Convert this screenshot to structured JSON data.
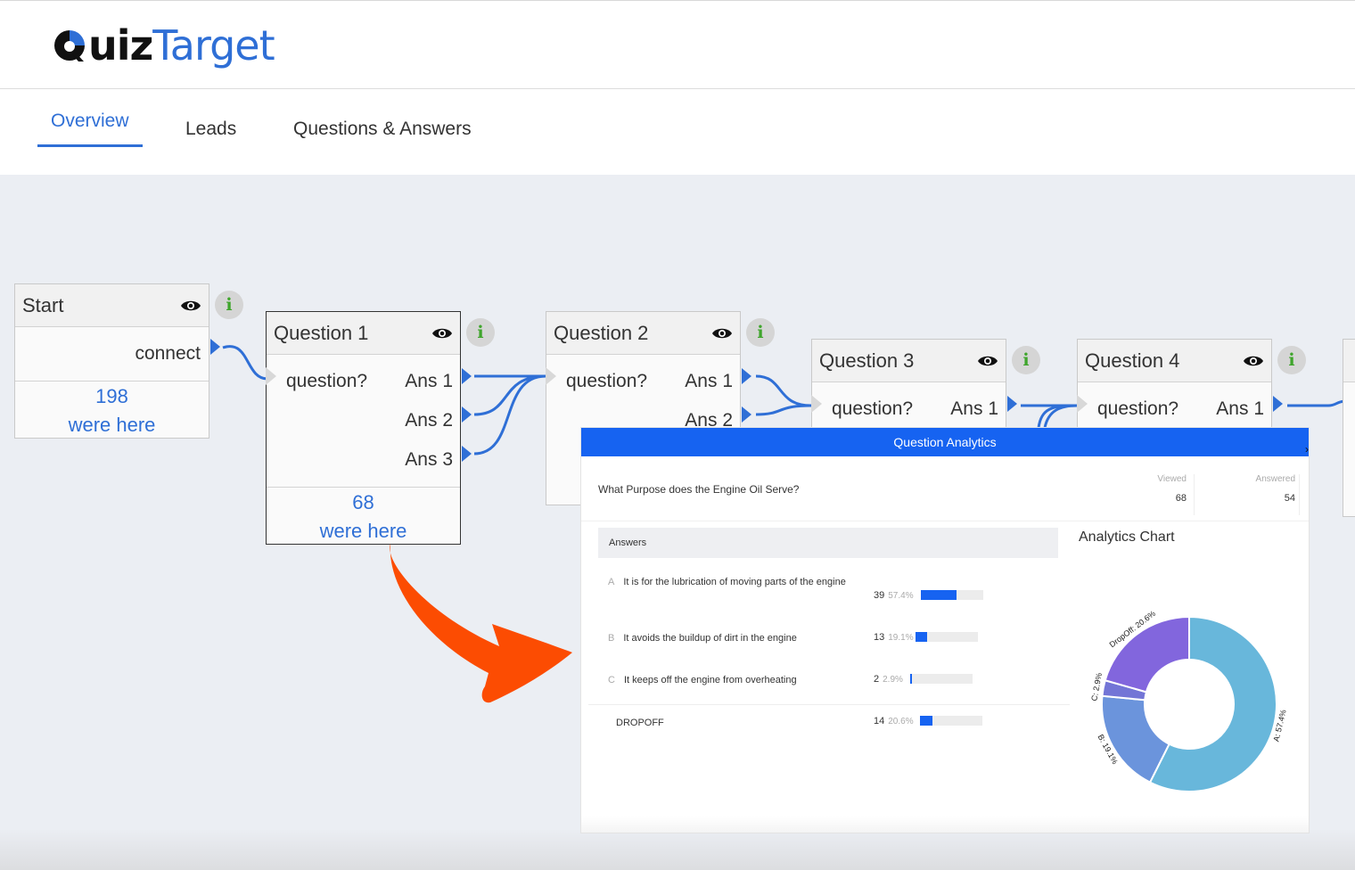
{
  "brand": {
    "name_part1": "uiz",
    "name_part2": "Target",
    "accent": "#2f6fd6"
  },
  "tabs": [
    {
      "label": "Overview",
      "active": true
    },
    {
      "label": "Leads",
      "active": false
    },
    {
      "label": "Questions & Answers",
      "active": false
    }
  ],
  "nodes": {
    "start": {
      "title": "Start",
      "output": "connect",
      "count": "198",
      "count_label": "were here"
    },
    "q1": {
      "title": "Question 1",
      "prompt": "question?",
      "answers": [
        "Ans 1",
        "Ans 2",
        "Ans 3"
      ],
      "count": "68",
      "count_label": "were here"
    },
    "q2": {
      "title": "Question 2",
      "prompt": "question?",
      "answers": [
        "Ans 1",
        "Ans 2"
      ]
    },
    "q3": {
      "title": "Question 3",
      "prompt": "question?",
      "answers": [
        "Ans 1"
      ]
    },
    "q4": {
      "title": "Question 4",
      "prompt": "question?",
      "answers": [
        "Ans 1"
      ]
    }
  },
  "analytics": {
    "title": "Question Analytics",
    "question": "What Purpose does the Engine Oil Serve?",
    "viewed_label": "Viewed",
    "viewed": "68",
    "answered_label": "Answered",
    "answered": "54",
    "answers_header": "Answers",
    "rows": [
      {
        "letter": "A",
        "text": "It is for the lubrication of moving parts of the engine",
        "count": "39",
        "pct": "57.4%",
        "fraction": 0.574
      },
      {
        "letter": "B",
        "text": "It avoids the buildup of dirt in the engine",
        "count": "13",
        "pct": "19.1%",
        "fraction": 0.191
      },
      {
        "letter": "C",
        "text": "It keeps off the engine from overheating",
        "count": "2",
        "pct": "2.9%",
        "fraction": 0.029
      }
    ],
    "dropoff": {
      "label": "DROPOFF",
      "count": "14",
      "pct": "20.6%",
      "fraction": 0.206
    },
    "chart_title": "Analytics Chart"
  },
  "chart_data": {
    "type": "pie",
    "donut": true,
    "slices": [
      {
        "label": "A",
        "value": 57.4,
        "text": "A: 57.4%",
        "color": "#68b7db"
      },
      {
        "label": "B",
        "value": 19.1,
        "text": "B: 19.1%",
        "color": "#6b94dc"
      },
      {
        "label": "C",
        "value": 2.9,
        "text": "C: 2.9%",
        "color": "#7375d6"
      },
      {
        "label": "DropOff",
        "value": 20.6,
        "text": "DropOff: 20.6%",
        "color": "#8266dd"
      }
    ]
  }
}
